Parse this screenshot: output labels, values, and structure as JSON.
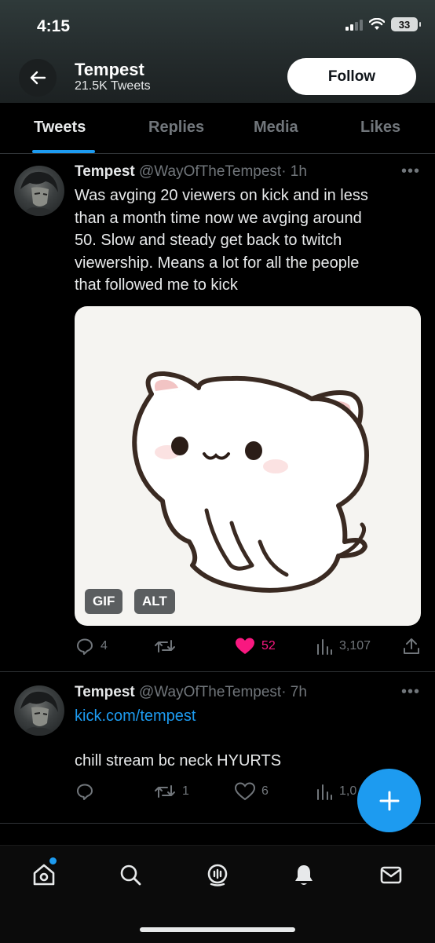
{
  "status_bar": {
    "time": "4:15",
    "battery": "33"
  },
  "header": {
    "name": "Tempest",
    "tweet_count": "21.5K Tweets",
    "follow_label": "Follow"
  },
  "tabs": [
    {
      "label": "Tweets",
      "active": true
    },
    {
      "label": "Replies",
      "active": false
    },
    {
      "label": "Media",
      "active": false
    },
    {
      "label": "Likes",
      "active": false
    }
  ],
  "tweets": [
    {
      "name": "Tempest",
      "handle": "@WayOfTheTempest",
      "time": "· 1h",
      "lines": [
        "Was avging 20 viewers on kick and in less",
        "than a month time now we avging around",
        "50. Slow and steady get back to twitch",
        "viewership. Means a lot for all the people",
        "that followed me to kick"
      ],
      "media": {
        "badge_gif": "GIF",
        "badge_alt": "ALT"
      },
      "replies": "4",
      "retweets": "",
      "likes": "52",
      "views": "3,107"
    },
    {
      "name": "Tempest",
      "handle": "@WayOfTheTempest",
      "time": "· 7h",
      "link": "kick.com/tempest",
      "text": "chill stream bc neck HYURTS",
      "replies": "",
      "retweets": "1",
      "likes": "6",
      "views": "1,0"
    }
  ],
  "colors": {
    "accent": "#1d9bf0",
    "like": "#f91880",
    "muted": "#71767b"
  },
  "icons": [
    "back-arrow-icon",
    "reply-icon",
    "retweet-icon",
    "heart-icon",
    "views-icon",
    "share-icon",
    "compose-icon",
    "home-icon",
    "search-icon",
    "spaces-icon",
    "notifications-icon",
    "messages-icon"
  ]
}
